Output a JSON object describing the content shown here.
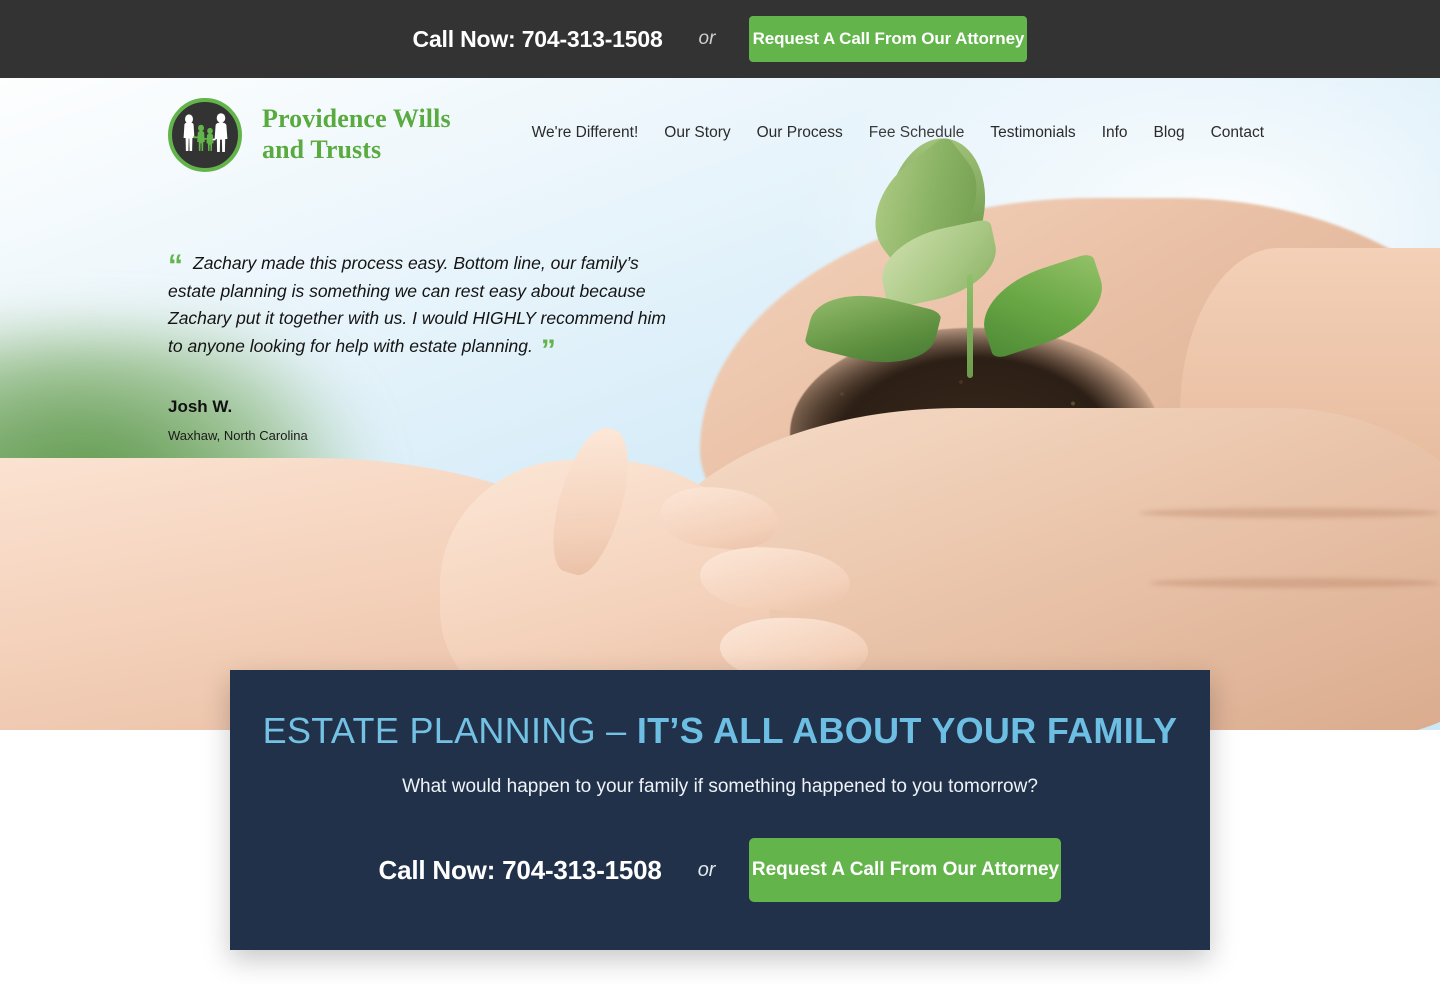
{
  "topbar": {
    "phone_label": "Call Now: 704-313-1508",
    "or_label": "or",
    "button_label": "Request A Call From Our Attorney"
  },
  "header": {
    "logo": {
      "icon": "family-silhouette-icon",
      "line1": "Providence Wills",
      "line2": "and Trusts"
    },
    "nav": [
      {
        "label": "We're Different!",
        "active": false
      },
      {
        "label": "Our Story",
        "active": false
      },
      {
        "label": "Our Process",
        "active": false
      },
      {
        "label": "Fee Schedule",
        "active": true
      },
      {
        "label": "Testimonials",
        "active": false
      },
      {
        "label": "Info",
        "active": false
      },
      {
        "label": "Blog",
        "active": false
      },
      {
        "label": "Contact",
        "active": false
      }
    ]
  },
  "hero": {
    "image_description": "Adult hands cradling soil with a young green seedling while a child's hand reaches toward them, blurred green foliage and blue sky background",
    "testimonial": {
      "open_quote": "“",
      "close_quote": "”",
      "text": "Zachary made this process easy. Bottom line, our family’s estate planning is something we can rest easy about because Zachary put it together with us. I would HIGHLY recommend him to anyone looking for help with estate planning.",
      "author": "Josh W.",
      "location": "Waxhaw, North Carolina"
    }
  },
  "cta_panel": {
    "heading_light": "ESTATE PLANNING – ",
    "heading_bold": "IT’S ALL ABOUT YOUR FAMILY",
    "subheading": "What would happen to your family if something happened to you tomorrow?",
    "phone_label": "Call Now: 704-313-1508",
    "or_label": "or",
    "button_label": "Request A Call From Our Attorney"
  },
  "colors": {
    "brand_green": "#63b44a",
    "logo_green": "#5aab3f",
    "topbar_dark": "#333333",
    "panel_dark": "#22314a",
    "panel_accent_blue": "#6cbee3"
  }
}
